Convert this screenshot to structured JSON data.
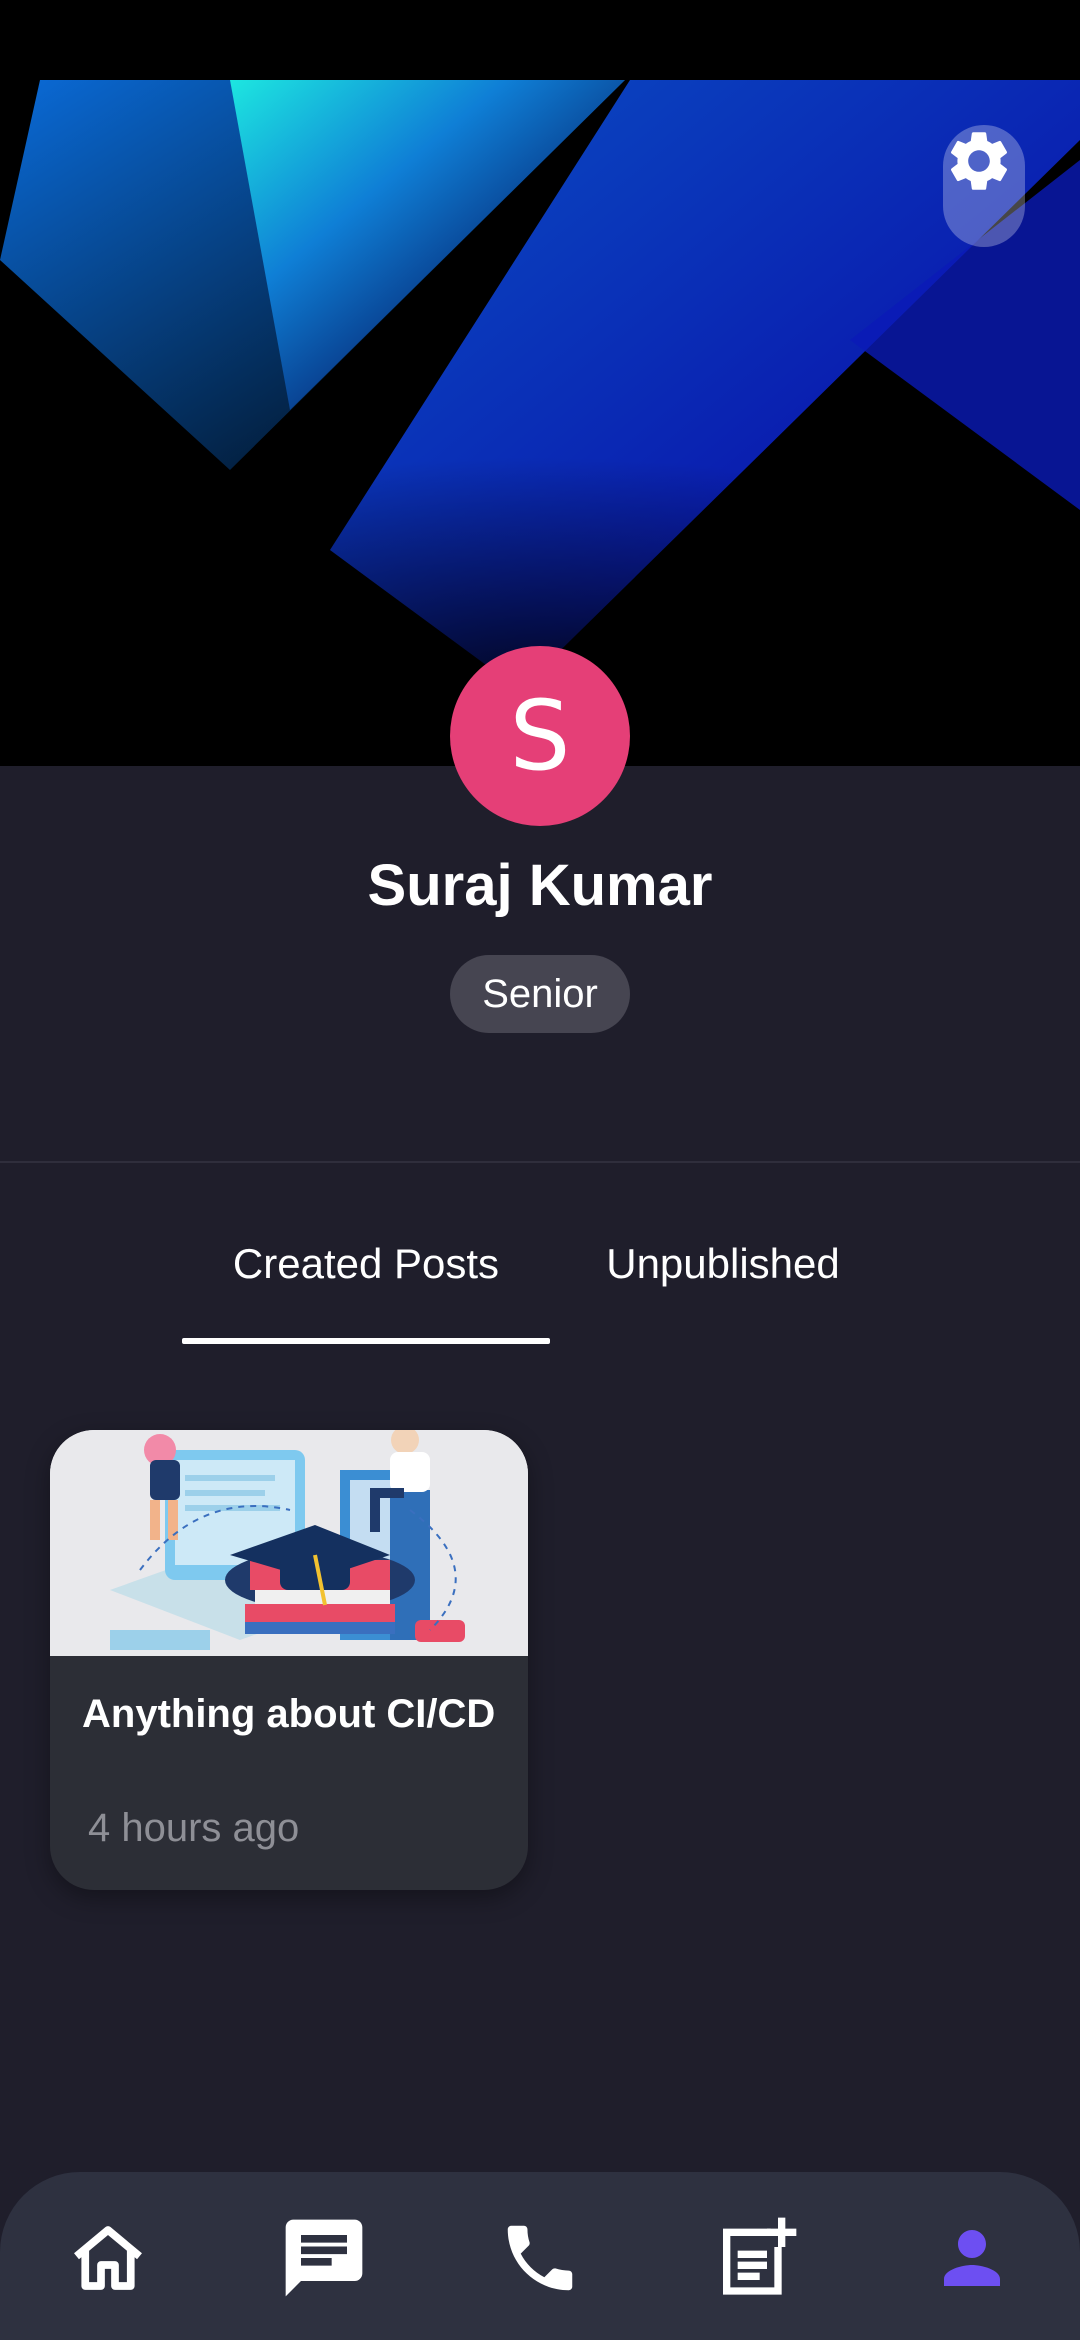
{
  "profile": {
    "avatar_letter": "S",
    "name": "Suraj Kumar",
    "role": "Senior",
    "avatar_color": "#e53f77"
  },
  "tabs": [
    {
      "label": "Created Posts",
      "active": true
    },
    {
      "label": "Unpublished",
      "active": false
    }
  ],
  "posts": [
    {
      "title": "Anything about CI/CD",
      "time": "4 hours ago"
    }
  ],
  "nav": {
    "items": [
      {
        "icon": "home-icon"
      },
      {
        "icon": "chat-icon"
      },
      {
        "icon": "phone-icon"
      },
      {
        "icon": "new-post-icon"
      },
      {
        "icon": "profile-icon",
        "active": true
      }
    ],
    "accent": "#6d4ff2"
  },
  "settings": {
    "icon": "gear-icon"
  }
}
